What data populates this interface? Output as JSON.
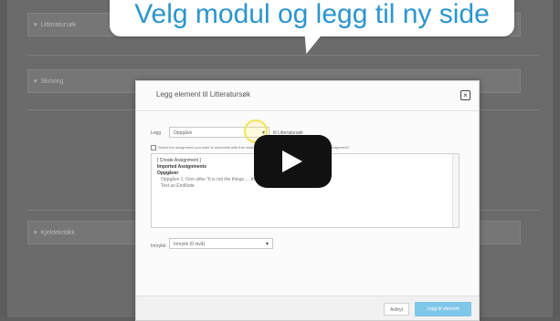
{
  "callout": {
    "text": "Velg modul og legg til ny side"
  },
  "background": {
    "sections": [
      "Litteratursøk",
      "Skriving",
      "Kjeldekritikk"
    ]
  },
  "modal": {
    "title": "Legg element til Litteratursøk",
    "add_label": "Legg",
    "type_select": "Oppgåve",
    "target_label": "til Litteratursøk",
    "hint": "Select the assignment you want to associate with this module, or add an assignment by selecting \"Create Assignment\".",
    "list": [
      {
        "text": "[ Create Assignment ]",
        "style": "normal"
      },
      {
        "text": "Imported Assignments",
        "style": "bold"
      },
      {
        "text": "Oppgåver",
        "style": "bold"
      },
      {
        "text": "Oppgåve 1: Finn ulike \"It is not the things … the sources\"",
        "style": "sub"
      },
      {
        "text": "Test av EndNote",
        "style": "sub"
      }
    ],
    "indent_label": "Innrykk:",
    "indent_select": "Innrykk (0 nivå)",
    "cancel_label": "Avbryt",
    "submit_label": "Legg til element"
  },
  "icons": {
    "close": "close-icon",
    "dropdown": "chevron-down-icon",
    "play": "play-icon"
  }
}
